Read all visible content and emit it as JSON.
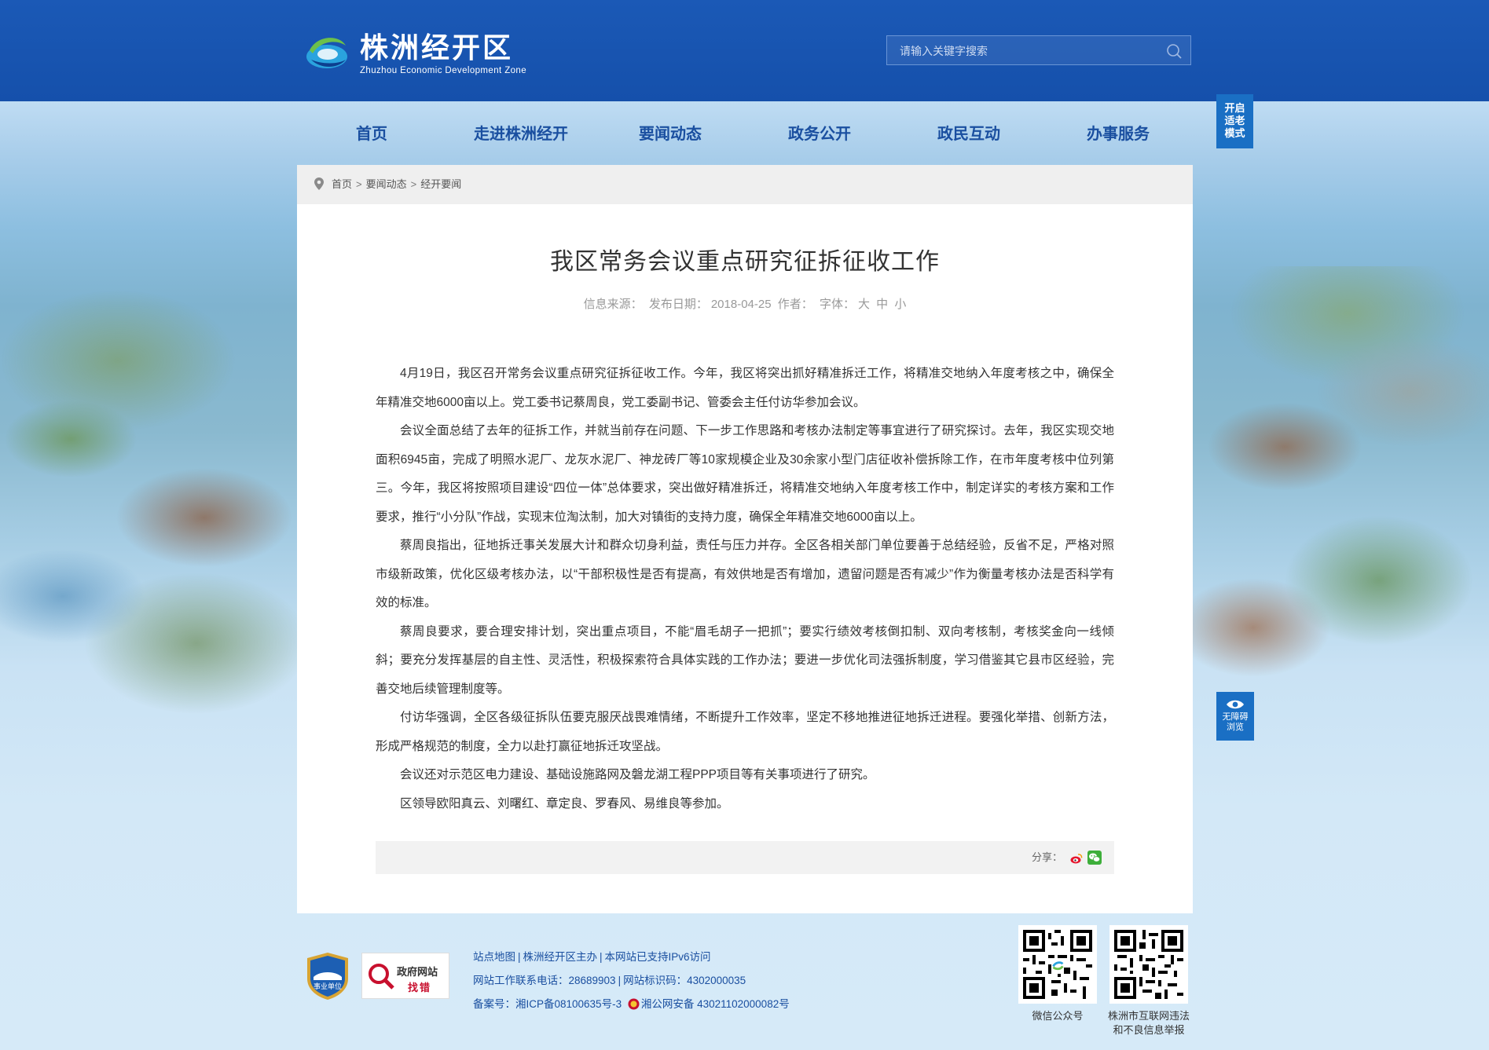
{
  "header": {
    "logo_cn": "株洲经开区",
    "logo_en": "Zhuzhou Economic Development Zone",
    "search_placeholder": "请输入关键字搜索"
  },
  "nav": {
    "items": [
      "首页",
      "走进株洲经开",
      "要闻动态",
      "政务公开",
      "政民互动",
      "办事服务"
    ],
    "elder_mode": [
      "开启",
      "适老",
      "模式"
    ]
  },
  "breadcrumb": [
    "首页",
    "要闻动态",
    "经开要闻"
  ],
  "article": {
    "title": "我区常务会议重点研究征拆征收工作",
    "meta": {
      "source_label": "信息来源：",
      "date_label": "发布日期：",
      "date": "2018-04-25",
      "author_label": "作者：",
      "font_label": "字体：",
      "font_large": "大",
      "font_medium": "中",
      "font_small": "小"
    },
    "paragraphs": [
      "4月19日，我区召开常务会议重点研究征拆征收工作。今年，我区将突出抓好精准拆迁工作，将精准交地纳入年度考核之中，确保全年精准交地6000亩以上。党工委书记蔡周良，党工委副书记、管委会主任付访华参加会议。",
      "会议全面总结了去年的征拆工作，并就当前存在问题、下一步工作思路和考核办法制定等事宜进行了研究探讨。去年，我区实现交地面积6945亩，完成了明照水泥厂、龙灰水泥厂、神龙砖厂等10家规模企业及30余家小型门店征收补偿拆除工作，在市年度考核中位列第三。今年，我区将按照项目建设“四位一体”总体要求，突出做好精准拆迁，将精准交地纳入年度考核工作中，制定详实的考核方案和工作要求，推行“小分队”作战，实现末位淘汰制，加大对镇街的支持力度，确保全年精准交地6000亩以上。",
      "蔡周良指出，征地拆迁事关发展大计和群众切身利益，责任与压力并存。全区各相关部门单位要善于总结经验，反省不足，严格对照市级新政策，优化区级考核办法，以“干部积极性是否有提高，有效供地是否有增加，遗留问题是否有减少”作为衡量考核办法是否科学有效的标准。",
      "蔡周良要求，要合理安排计划，突出重点项目，不能“眉毛胡子一把抓”；要实行绩效考核倒扣制、双向考核制，考核奖金向一线倾斜；要充分发挥基层的自主性、灵活性，积极探索符合具体实践的工作办法；要进一步优化司法强拆制度，学习借鉴其它县市区经验，完善交地后续管理制度等。",
      "付访华强调，全区各级征拆队伍要克服厌战畏难情绪，不断提升工作效率，坚定不移地推进征地拆迁进程。要强化举措、创新方法，形成严格规范的制度，全力以赴打赢征地拆迁攻坚战。",
      "会议还对示范区电力建设、基础设施路网及磐龙湖工程PPP项目等有关事项进行了研究。",
      "区领导欧阳真云、刘曙红、章定良、罗春风、易维良等参加。"
    ],
    "share_label": "分享："
  },
  "sidebar_float": {
    "a11y_line1": "无障碍",
    "a11y_line2": "浏览"
  },
  "footer": {
    "badge_shiye": "事业单位",
    "zhaocuo_line1": "政府网站",
    "zhaocuo_line2": "找错",
    "links": [
      "站点地图",
      "株洲经开区主办",
      "本网站已支持IPv6访问"
    ],
    "contact": "网站工作联系电话：28689903",
    "site_id": "网站标识码：4302000035",
    "icp": "备案号：湘ICP备08100635号-3",
    "police": "湘公网安备 43021102000082号",
    "qr1_label": "微信公众号",
    "qr2_label_line1": "株洲市互联网违法",
    "qr2_label_line2": "和不良信息举报"
  },
  "colors": {
    "header_blue": "#1550ab",
    "nav_text": "#1a4fa0",
    "float_blue": "#1a6fc4"
  }
}
